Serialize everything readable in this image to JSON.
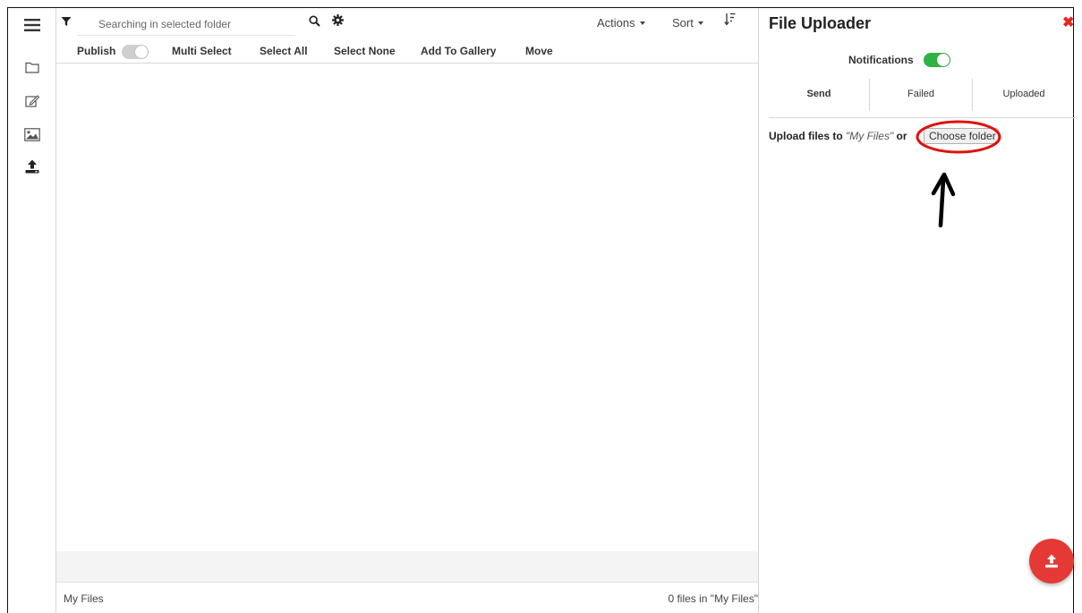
{
  "search": {
    "placeholder": "Searching in selected folder"
  },
  "topbar": {
    "actions_label": "Actions",
    "sort_label": "Sort"
  },
  "toolbar": {
    "publish_label": "Publish",
    "publish_on": false,
    "multi_select_label": "Multi Select",
    "select_all_label": "Select All",
    "select_none_label": "Select None",
    "add_to_gallery_label": "Add To Gallery",
    "move_label": "Move"
  },
  "footer": {
    "location": "My Files",
    "count_text": "0 files in \"My Files\""
  },
  "uploader": {
    "title": "File Uploader",
    "notifications_label": "Notifications",
    "notifications_on": true,
    "tabs": [
      {
        "label": "Send",
        "active": true
      },
      {
        "label": "Failed",
        "active": false
      },
      {
        "label": "Uploaded",
        "active": false
      }
    ],
    "upload_prefix": "Upload files to ",
    "upload_target": "\"My Files\"",
    "upload_or": " or ",
    "choose_folder_label": "Choose folder"
  },
  "colors": {
    "accent_red": "#e53935",
    "toggle_on": "#2fb244",
    "toggle_off": "#cfcfcf",
    "annotation_red": "#e01010"
  },
  "icons": {
    "rail": [
      "menu-icon",
      "folder-icon",
      "edit-icon",
      "image-icon",
      "upload-icon"
    ],
    "topbar": [
      "filter-icon",
      "search-icon",
      "gear-icon",
      "sort-order-icon"
    ],
    "panel": [
      "close-icon",
      "upload-fab-icon"
    ]
  }
}
